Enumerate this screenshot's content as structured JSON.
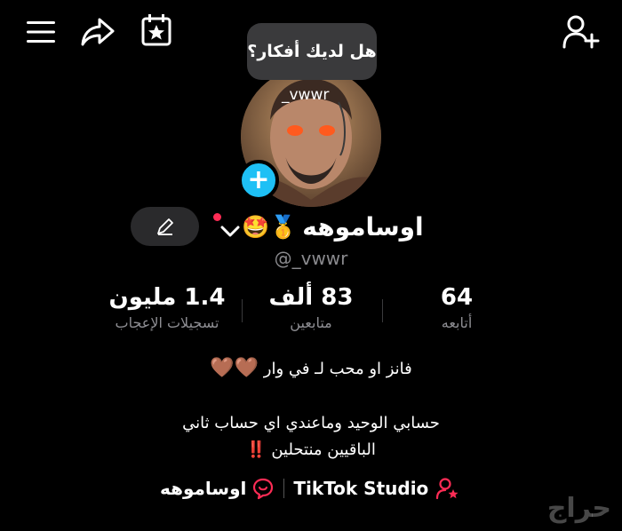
{
  "header": {
    "menu_icon": "hamburger-icon",
    "share_icon": "share-arrow-icon",
    "calendar_icon": "calendar-star-icon",
    "add_friend_icon": "add-user-icon"
  },
  "tooltip": {
    "text": "هل لديك أفكار؟"
  },
  "avatar": {
    "overlay_text": "_vwwr"
  },
  "profile": {
    "name": "اوساموهه",
    "badges": "🤩🥇",
    "handle": "@_vwwr"
  },
  "stats": [
    {
      "value": "64",
      "label": "أتابعه"
    },
    {
      "value": "83 ألف",
      "label": "متابعين"
    },
    {
      "value": "1.4 مليون",
      "label": "تسجيلات الإعجاب"
    }
  ],
  "bio": {
    "line1": "فانز او محب لـ في وار",
    "line1_emoji": "🤎🤎",
    "line2": "حسابي الوحيد وماعندي اي حساب ثاني",
    "line3": "الباقيين منتحلين",
    "line3_emoji": "‼️"
  },
  "links": {
    "studio": "TikTok Studio",
    "community": "اوساموهه"
  },
  "watermark": "حراج",
  "colors": {
    "accent": "#1ec0f5",
    "pink": "#fe2c55",
    "muted": "#8e8e93"
  }
}
